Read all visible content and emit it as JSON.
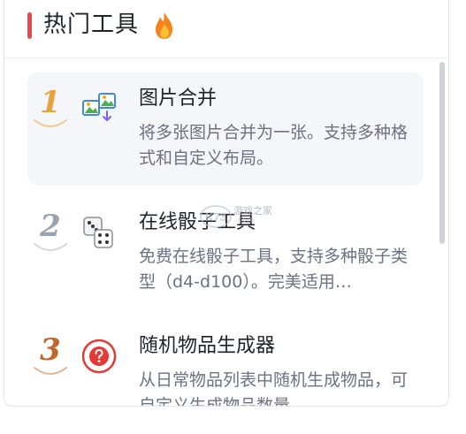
{
  "header": {
    "title": "热门工具",
    "accent_color": "#e5484d",
    "icon": "fire-icon"
  },
  "tools": [
    {
      "rank": "1",
      "rank_color": "#e6a23c",
      "icon": "image-merge-icon",
      "title": "图片合并",
      "description": "将多张图片合并为一张。支持多种格式和自定义布局。",
      "highlighted": true
    },
    {
      "rank": "2",
      "rank_color": "#9aa3b2",
      "icon": "dice-icon",
      "title": "在线骰子工具",
      "description": "免费在线骰子工具，支持多种骰子类型（d4-d100）。完美适用…",
      "highlighted": false
    },
    {
      "rank": "3",
      "rank_color": "#c0652c",
      "icon": "question-badge-icon",
      "title": "随机物品生成器",
      "description": "从日常物品列表中随机生成物品，可自定义生成物品数量。",
      "highlighted": false
    }
  ],
  "watermark": {
    "logo": "K73",
    "text": "游戏之家",
    "subtext": ".com"
  }
}
